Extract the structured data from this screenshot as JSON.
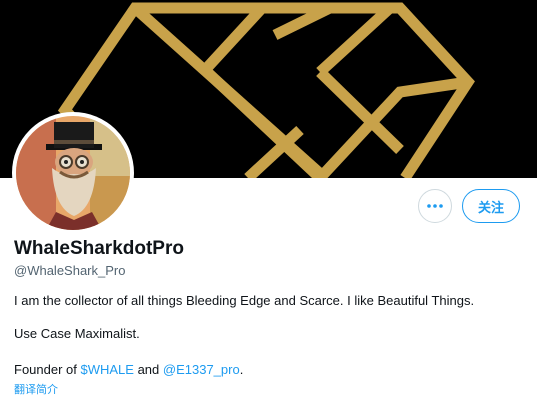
{
  "profile": {
    "display_name": "WhaleSharkdotPro",
    "handle": "@WhaleShark_Pro",
    "bio_line_1": "I am the collector of all things Bleeding Edge and Scarce. I like Beautiful Things.",
    "bio_line_2": "Use Case Maximalist.",
    "bio_line_3_prefix": "Founder of ",
    "bio_link_1": "$WHALE",
    "bio_line_3_mid": " and ",
    "bio_link_2": "@E1337_pro",
    "bio_line_3_suffix": ".",
    "translate_label": "翻译简介"
  },
  "actions": {
    "more_icon": "more-horizontal-icon",
    "follow_label": "关注"
  },
  "colors": {
    "accent": "#1d9bf0",
    "banner_bg": "#000000",
    "banner_gold": "#c8a24a",
    "text_primary": "#0f1419",
    "text_secondary": "#536471"
  }
}
